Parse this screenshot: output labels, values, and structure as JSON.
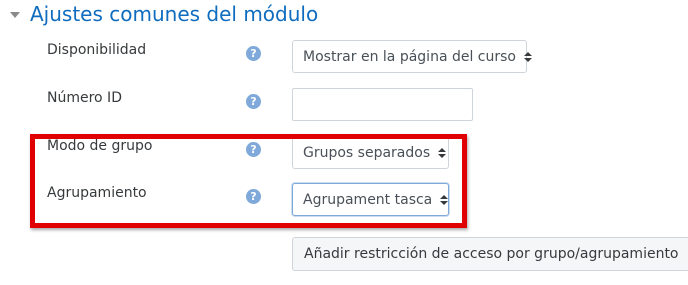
{
  "section": {
    "title": "Ajustes comunes del módulo",
    "collapse_icon": "caret-down-icon"
  },
  "fields": [
    {
      "label": "Disponibilidad",
      "type": "select",
      "value": "Mostrar en la página del curso"
    },
    {
      "label": "Número ID",
      "type": "text",
      "value": ""
    },
    {
      "label": "Modo de grupo",
      "type": "select",
      "value": "Grupos separados"
    },
    {
      "label": "Agrupamiento",
      "type": "select",
      "value": "Agrupament tasca"
    }
  ],
  "help_icon": {
    "glyph": "?",
    "name": "help-icon",
    "color": "#7fa9d9"
  },
  "button": {
    "label": "Añadir restricción de acceso por grupo/agrupamiento"
  },
  "colors": {
    "accent": "#0f6cbf",
    "highlight": "#e00000"
  }
}
